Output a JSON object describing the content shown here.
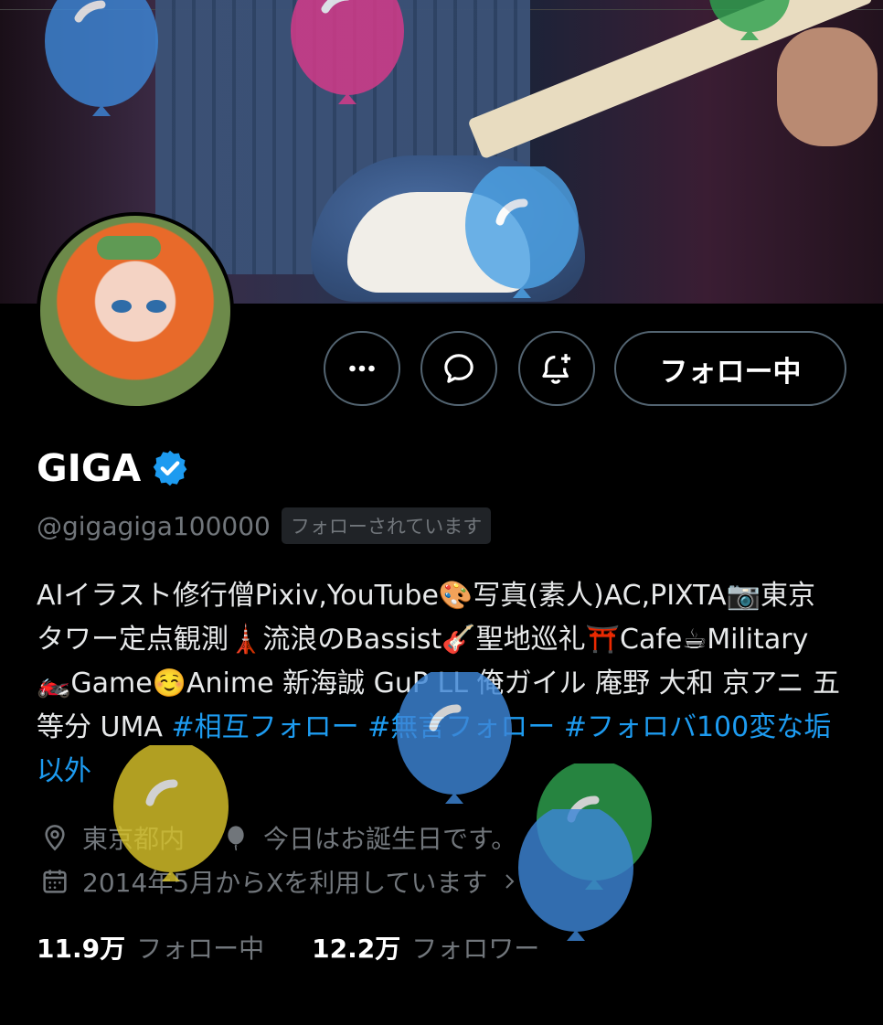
{
  "profile": {
    "display_name": "GIGA",
    "handle": "@gigagiga100000",
    "follows_you_badge": "フォローされています",
    "bio_plain": "AIイラスト修行僧Pixiv,YouTube🎨写真(素人)AC,PIXTA📷東京タワー定点観測🗼流浪のBassist🎸聖地巡礼⛩️Cafe☕Military🏍️Game☺️Anime 新海誠 GuP LL 俺ガイル 庵野 大和 京アニ 五等分 UMA ",
    "bio_tags": [
      "#相互フォロー",
      "#無言フォロー",
      "#フォロバ100変な垢以外"
    ],
    "location": "東京都内",
    "birthday": "今日はお誕生日です。",
    "joined": "2014年5月からXを利用しています",
    "following_count": "11.9万",
    "following_label": "フォロー中",
    "followers_count": "12.2万",
    "followers_label": "フォロワー"
  },
  "actions": {
    "follow_button_label": "フォロー中"
  },
  "icons": [
    "more-icon",
    "message-icon",
    "notification-add-icon",
    "verified-badge-icon",
    "location-pin-icon",
    "balloon-icon",
    "calendar-icon",
    "chevron-right-icon"
  ],
  "colors": {
    "accent_blue": "#1d9bf0",
    "verified_blue": "#1d9bf0",
    "secondary_text": "#71767b",
    "background": "#000000",
    "balloon_blue": "#3d86d6",
    "balloon_pink": "#d93a8a",
    "balloon_green": "#2fa24f",
    "balloon_yellow": "#d8c32a",
    "balloon_light_blue": "#4da3e6"
  }
}
